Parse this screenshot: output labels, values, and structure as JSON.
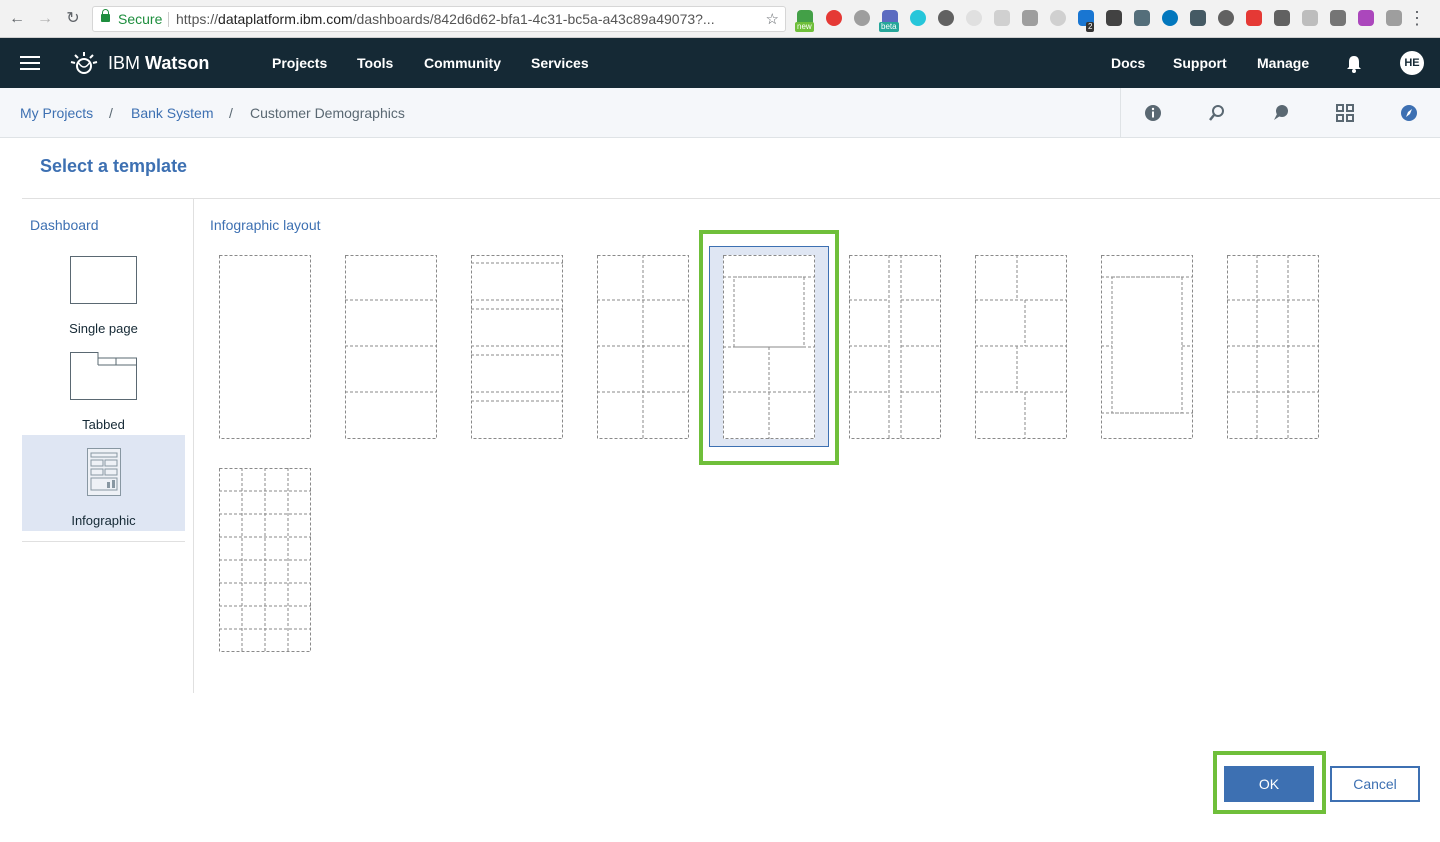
{
  "browser": {
    "secure_label": "Secure",
    "url_scheme": "https://",
    "url_host": "dataplatform.ibm.com",
    "url_path": "/dashboards/842d6d62-bfa1-4c31-bc5a-a43c89a49073?...",
    "extension_badges": [
      "new",
      "beta",
      "2"
    ]
  },
  "topnav": {
    "brand_light": "IBM ",
    "brand_bold": "Watson",
    "items": [
      "Projects",
      "Tools",
      "Community",
      "Services"
    ],
    "right_items": [
      "Docs",
      "Support",
      "Manage"
    ],
    "avatar_initials": "HE"
  },
  "breadcrumb": {
    "items": [
      "My Projects",
      "Bank System",
      "Customer Demographics"
    ],
    "separator": "/"
  },
  "panel": {
    "title": "Select a template",
    "sidebar_heading": "Dashboard",
    "sidebar_options": [
      "Single page",
      "Tabbed",
      "Infographic"
    ],
    "selected_option": "Infographic",
    "layout_heading": "Infographic layout",
    "template_count": 10,
    "selected_template_index": 5
  },
  "buttons": {
    "ok": "OK",
    "cancel": "Cancel"
  },
  "colors": {
    "accent": "#3d70b2",
    "nav_bg": "#152935",
    "highlight": "#6fbf3a",
    "selected_bg": "#dfe6f3"
  }
}
